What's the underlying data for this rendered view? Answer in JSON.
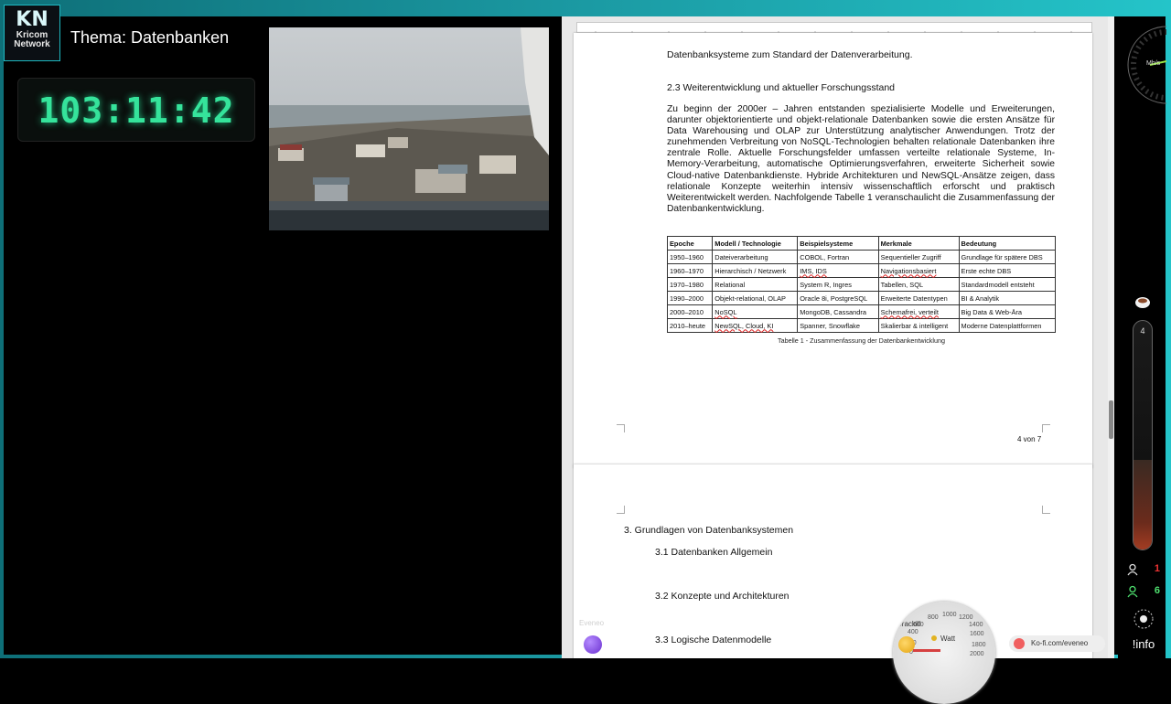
{
  "overlay": {
    "logo": {
      "line1": "KN",
      "line2": "Kricom",
      "line3": "Network"
    },
    "theme_title": "Thema: Datenbanken",
    "timer": "103:11:42",
    "speed_unit": "Mh/s",
    "coffee_level": "4",
    "users": [
      {
        "count": "1"
      },
      {
        "count": "6"
      }
    ],
    "info_label": "!info",
    "kofi_text": "Ko-fi.com/eveneo",
    "gauge_label": "Watt",
    "orb_label": "Eveneo",
    "gauge_title": "Crackill",
    "gauge_ticks": [
      "800",
      "1000",
      "1200",
      "600",
      "1400",
      "400",
      "1600",
      "200",
      "1800",
      "0",
      "2000"
    ]
  },
  "document": {
    "page1": {
      "prev_line": "Datenbanksysteme zum Standard der Datenverarbeitung.",
      "heading": "2.3 Weiterentwicklung und aktueller Forschungsstand",
      "paragraph": "Zu beginn der 2000er – Jahren entstanden spezialisierte Modelle und Erweiterungen, darunter objektorientierte und objekt-relationale Datenbanken sowie die ersten Ansätze für Data Warehousing und OLAP zur Unterstützung analytischer Anwendungen. Trotz der zunehmenden Verbreitung von NoSQL-Technologien behalten relationale Datenbanken ihre zentrale Rolle. Aktuelle Forschungsfelder umfassen verteilte relationale Systeme, In-Memory-Verarbeitung, automatische Optimierungsverfahren, erweiterte Sicherheit sowie Cloud-native Datenbankdienste. Hybride Architekturen und NewSQL-Ansätze zeigen, dass relationale Konzepte weiterhin intensiv wissenschaftlich erforscht und praktisch Weiterentwickelt werden. Nachfolgende Tabelle 1 veranschaulicht die Zusammenfassung der                                                Datenbankentwicklung.",
      "table": {
        "headers": [
          "Epoche",
          "Modell / Technologie",
          "Beispielsysteme",
          "Merkmale",
          "Bedeutung"
        ],
        "rows": [
          [
            "1950–1960",
            "Dateiverarbeitung",
            "COBOL, Fortran",
            "Sequentieller Zugriff",
            "Grundlage für spätere DBS"
          ],
          [
            "1960–1970",
            "Hierarchisch / Netzwerk",
            "IMS, IDS",
            "Navigationsbasiert",
            "Erste echte DBS"
          ],
          [
            "1970–1980",
            "Relational",
            "System R, Ingres",
            "Tabellen, SQL",
            "Standardmodell entsteht"
          ],
          [
            "1990–2000",
            "Objekt-relational, OLAP",
            "Oracle 8i, PostgreSQL",
            "Erweiterte Datentypen",
            "BI & Analytik"
          ],
          [
            "2000–2010",
            "NoSQL",
            "MongoDB, Cassandra",
            "Schemafrei, verteilt",
            "Big Data & Web-Ära"
          ],
          [
            "2010–heute",
            "NewSQL, Cloud, KI",
            "Spanner, Snowflake",
            "Skalierbar & intelligent",
            "Moderne Datenplattformen"
          ]
        ]
      },
      "caption": "Tabelle 1 - Zusammenfassung der Datenbankentwicklung",
      "page_number": "4 von 7"
    },
    "page2": {
      "heading": "3. Grundlagen von Datenbanksystemen",
      "sub1": "3.1 Datenbanken Allgemein",
      "sub2": "3.2 Konzepte und Architekturen",
      "sub3": "3.3 Logische Datenmodelle"
    }
  }
}
